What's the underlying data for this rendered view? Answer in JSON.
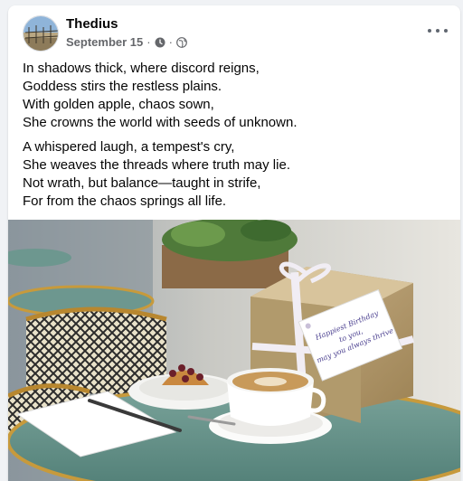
{
  "post": {
    "author": "Thedius",
    "date": "September 15",
    "separator": "·",
    "icons": {
      "time": "clock-icon",
      "audience": "globe-icon",
      "menu": "more-dots-icon"
    },
    "stanza1": [
      "In shadows thick, where discord reigns,",
      "Goddess stirs the restless plains.",
      "With golden apple, chaos sown,",
      "She crowns the world with seeds of unknown."
    ],
    "stanza2": [
      "A whispered laugh, a tempest's cry,",
      "She weaves the threads where truth may lie.",
      "Not wrath, but balance—taught in strife,",
      "For from the chaos springs all life."
    ],
    "photo": {
      "card_text": [
        "Happiest Birthday",
        "to you,",
        "may you always thrive"
      ],
      "colors": {
        "table": "#5f8f86",
        "gift": "#b59a6a",
        "ribbon": "#f3f0f5",
        "cup": "#ffffff",
        "coffee": "#c89a5a"
      }
    }
  }
}
